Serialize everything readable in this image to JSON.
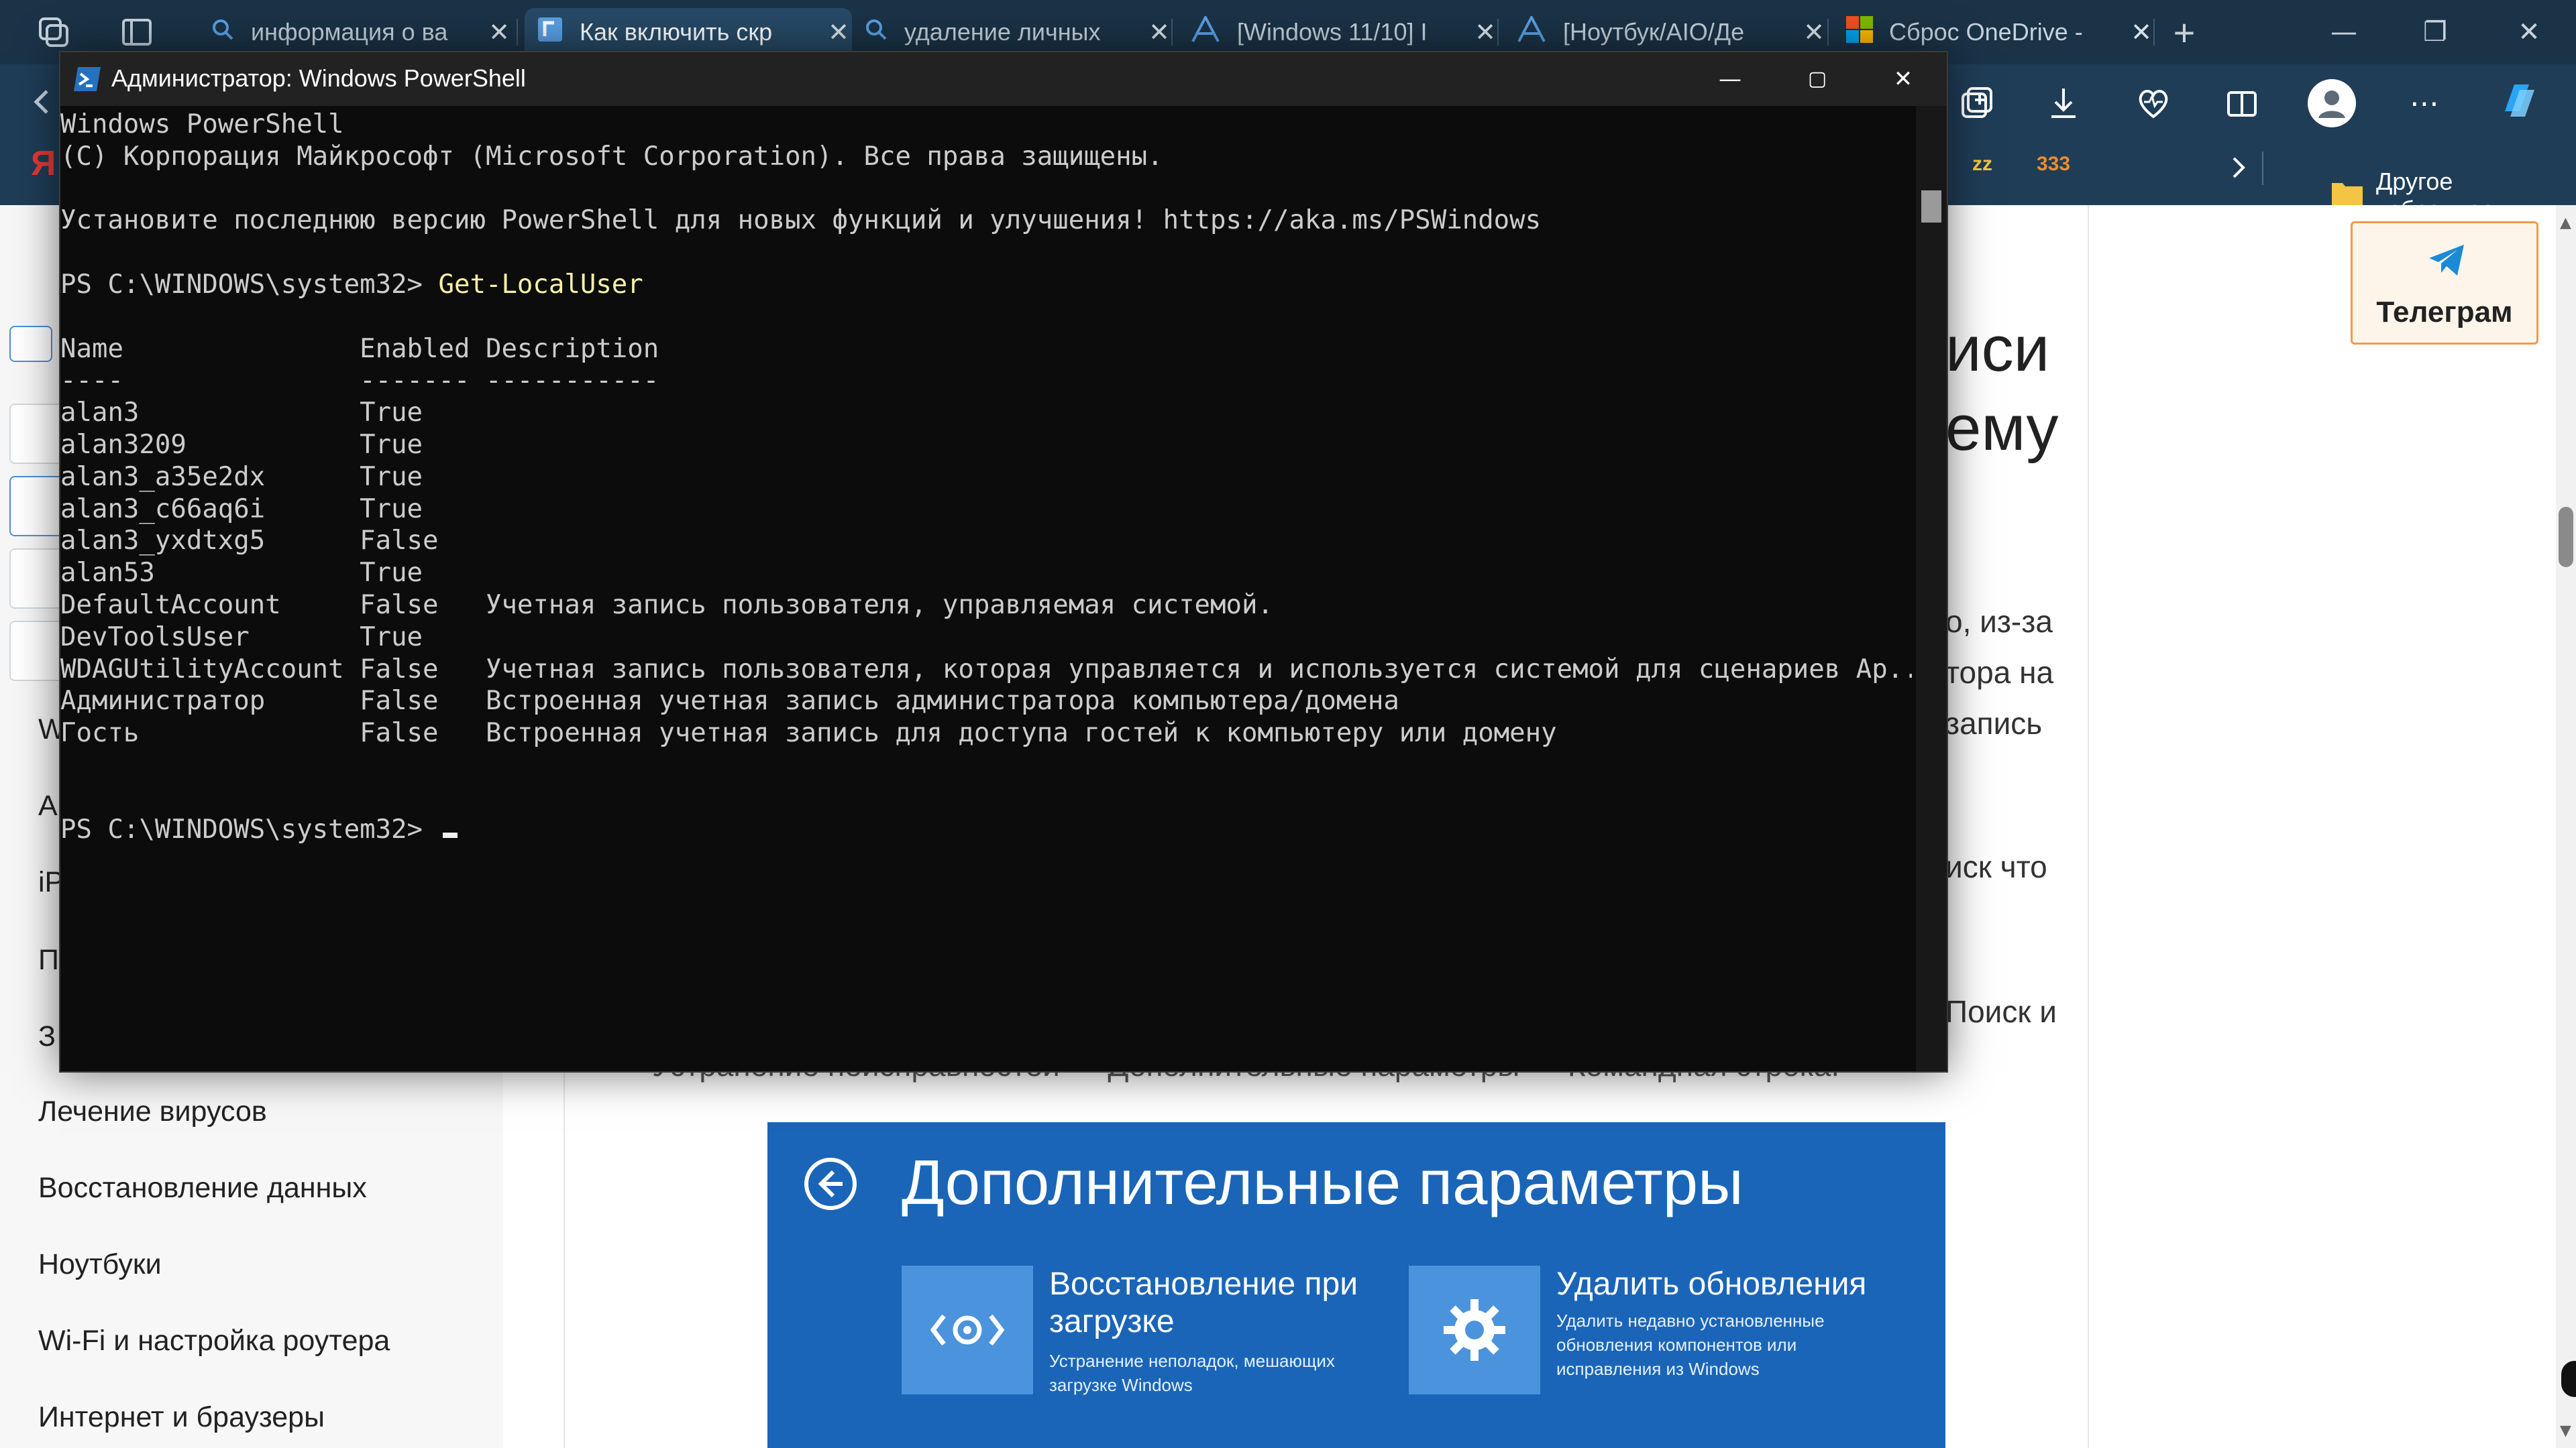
{
  "browser": {
    "tabs": [
      {
        "title": "информация о ва",
        "icon": "search-icon",
        "active": false
      },
      {
        "title": "Как включить скр",
        "icon": "site-icon",
        "active": true
      },
      {
        "title": "удаление личных",
        "icon": "search-icon",
        "active": false
      },
      {
        "title": "[Windows 11/10] I",
        "icon": "asus-icon",
        "active": false
      },
      {
        "title": "[Ноутбук/AIO/Де",
        "icon": "asus-icon",
        "active": false
      },
      {
        "title": "Сброс OneDrive -",
        "icon": "microsoft-icon",
        "active": false
      }
    ],
    "new_tab": "+",
    "close_glyph": "✕",
    "favorites_other": "Другое избранное",
    "fav_partial_1": "zz",
    "fav_partial_2": "333",
    "brand_partial": "Я"
  },
  "page": {
    "sidebar": {
      "items": [
        "Лечение вирусов",
        "Восстановление данных",
        "Ноутбуки",
        "Wi-Fi и настройка роутера",
        "Интернет и браузеры"
      ],
      "partial_items": [
        "W",
        "A",
        "iP",
        "П",
        "З"
      ]
    },
    "article": {
      "heading_frag_1": "иси",
      "heading_frag_2": "ему",
      "text_frag_1": "о, из-за",
      "text_frag_2": "тора на",
      "text_frag_3": "запись",
      "text_frag_4": "иск что",
      "text_frag_5": "Поиск и",
      "text_frag_6": "Устранение неисправностей — Дополнительные параметры — Командная строка."
    },
    "telegram_label": "Телеграм",
    "recovery": {
      "title": "Дополнительные параметры",
      "options": [
        {
          "title": "Восстановление при загрузке",
          "desc": "Устранение неполадок, мешающих загрузке Windows"
        },
        {
          "title": "Удалить обновления",
          "desc": "Удалить недавно установленные обновления компонентов или исправления из Windows"
        }
      ]
    }
  },
  "powershell": {
    "title": "Администратор: Windows PowerShell",
    "lines": [
      {
        "text": "Windows PowerShell"
      },
      {
        "text": "(C) Корпорация Майкрософт (Microsoft Corporation). Все права защищены."
      },
      {
        "text": ""
      },
      {
        "text": "Установите последнюю версию PowerShell для новых функций и улучшения! https://aka.ms/PSWindows"
      },
      {
        "text": ""
      },
      {
        "prompt": "PS C:\\WINDOWS\\system32> ",
        "cmd": "Get-LocalUser"
      },
      {
        "text": ""
      },
      {
        "text": "Name               Enabled Description"
      },
      {
        "text": "----               ------- -----------"
      },
      {
        "text": "alan3              True"
      },
      {
        "text": "alan3209           True"
      },
      {
        "text": "alan3_a35e2dx      True"
      },
      {
        "text": "alan3_c66aq6i      True"
      },
      {
        "text": "alan3_yxdtxg5      False"
      },
      {
        "text": "alan53             True"
      },
      {
        "text": "DefaultAccount     False   Учетная запись пользователя, управляемая системой."
      },
      {
        "text": "DevToolsUser       True"
      },
      {
        "text": "WDAGUtilityAccount False   Учетная запись пользователя, которая управляется и используется системой для сценариев Ap..."
      },
      {
        "text": "Администратор      False   Встроенная учетная запись администратора компьютера/домена"
      },
      {
        "text": "Гость              False   Встроенная учетная запись для доступа гостей к компьютеру или домену"
      },
      {
        "text": ""
      },
      {
        "text": ""
      },
      {
        "prompt": "PS C:\\WINDOWS\\system32> ",
        "cmd": "",
        "cursor": true
      }
    ]
  }
}
